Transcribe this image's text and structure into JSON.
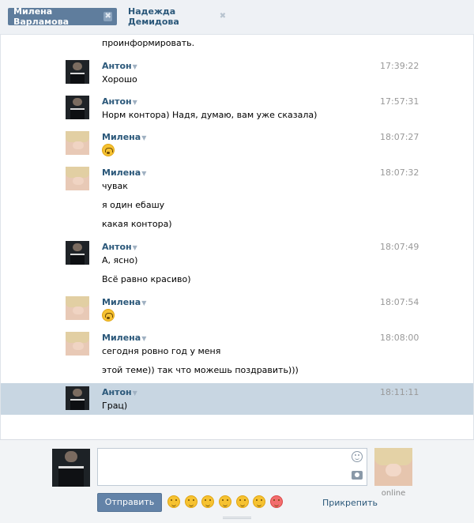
{
  "tabs": [
    {
      "label": "Милена Варламова",
      "close": "✖"
    },
    {
      "label": "Надежда Демидова",
      "close": "✖"
    }
  ],
  "history": {
    "top_partial_text": "проинформировать.",
    "arrow": "▼",
    "messages": [
      {
        "author": "Антон",
        "time": "17:39:22",
        "lines": [
          "Хорошо"
        ]
      },
      {
        "author": "Антон",
        "time": "17:57:31",
        "lines": [
          "Норм контора) Надя, думаю, вам уже сказала)"
        ]
      },
      {
        "author": "Милена",
        "time": "18:07:27",
        "emoji": "upside-down-smile"
      },
      {
        "author": "Милена",
        "time": "18:07:32",
        "lines": [
          "чувак",
          "я один ебашу",
          "какая контора)"
        ]
      },
      {
        "author": "Антон",
        "time": "18:07:49",
        "lines": [
          "А, ясно)",
          "Всё равно красиво)"
        ]
      },
      {
        "author": "Милена",
        "time": "18:07:54",
        "emoji": "upside-down-smile"
      },
      {
        "author": "Милена",
        "time": "18:08:00",
        "lines": [
          "сегодня ровно год у меня",
          "этой теме)) так что можешь поздравить)))"
        ]
      },
      {
        "author": "Антон",
        "time": "18:11:11",
        "lines": [
          "Грац)"
        ]
      }
    ]
  },
  "composer": {
    "input_value": "",
    "send_label": "Отправить",
    "attach_label": "Прикрепить",
    "partner_status": "online",
    "quick_emojis": [
      "smile",
      "blush",
      "laugh",
      "kiss",
      "rolling-eyes",
      "smirk",
      "heart-eyes"
    ]
  }
}
